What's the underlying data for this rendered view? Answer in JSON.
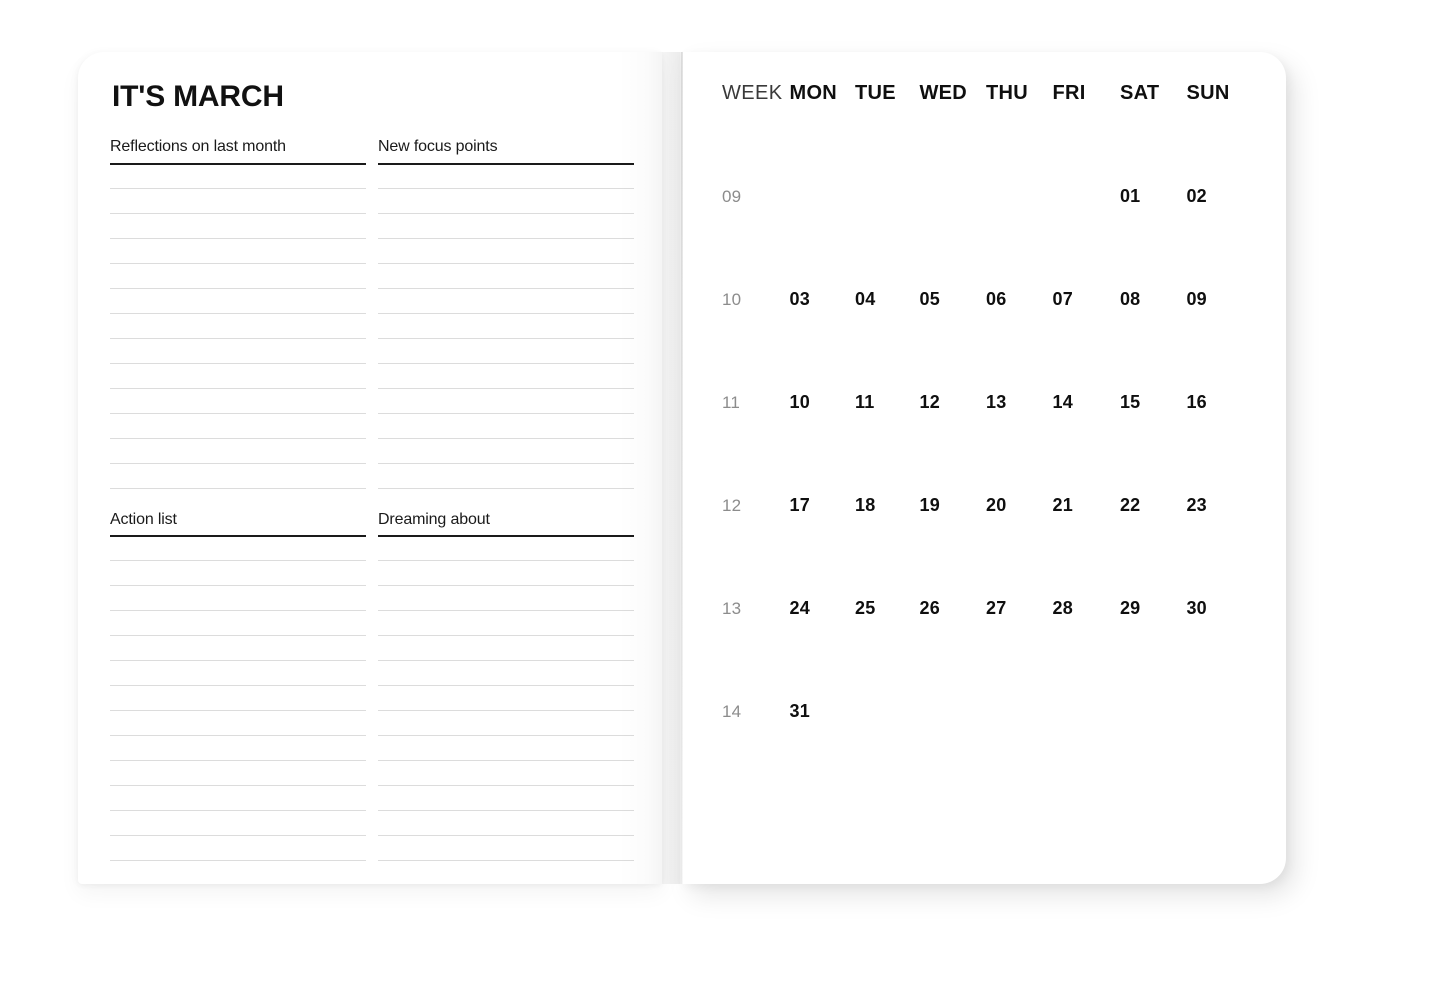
{
  "spread": {
    "type": "planner-monthly-spread"
  },
  "left_page": {
    "title": "IT'S MARCH",
    "sections": [
      {
        "name": "top",
        "fields": [
          {
            "label": "Reflections on last month",
            "line_count": 13
          },
          {
            "label": "New focus points",
            "line_count": 13
          }
        ]
      },
      {
        "name": "bottom",
        "fields": [
          {
            "label": "Action list",
            "line_count": 13
          },
          {
            "label": "Dreaming about",
            "line_count": 13
          }
        ]
      }
    ]
  },
  "right_page": {
    "header": {
      "week_label": "WEEK",
      "days": [
        "MON",
        "TUE",
        "WED",
        "THU",
        "FRI",
        "SAT",
        "SUN"
      ]
    },
    "weeks": [
      {
        "week": "09",
        "days": [
          "",
          "",
          "",
          "",
          "",
          "01",
          "02"
        ]
      },
      {
        "week": "10",
        "days": [
          "03",
          "04",
          "05",
          "06",
          "07",
          "08",
          "09"
        ]
      },
      {
        "week": "11",
        "days": [
          "10",
          "11",
          "12",
          "13",
          "14",
          "15",
          "16"
        ]
      },
      {
        "week": "12",
        "days": [
          "17",
          "18",
          "19",
          "20",
          "21",
          "22",
          "23"
        ]
      },
      {
        "week": "13",
        "days": [
          "24",
          "25",
          "26",
          "27",
          "28",
          "29",
          "30"
        ]
      },
      {
        "week": "14",
        "days": [
          "31",
          "",
          "",
          "",
          "",
          "",
          ""
        ]
      }
    ]
  },
  "colors": {
    "page": "#ffffff",
    "ink": "#111111",
    "muted": "#8c8c8c",
    "rule_strong": "#1a1a1a",
    "rule_light": "#dcdcdc",
    "background": "#ffffff"
  }
}
